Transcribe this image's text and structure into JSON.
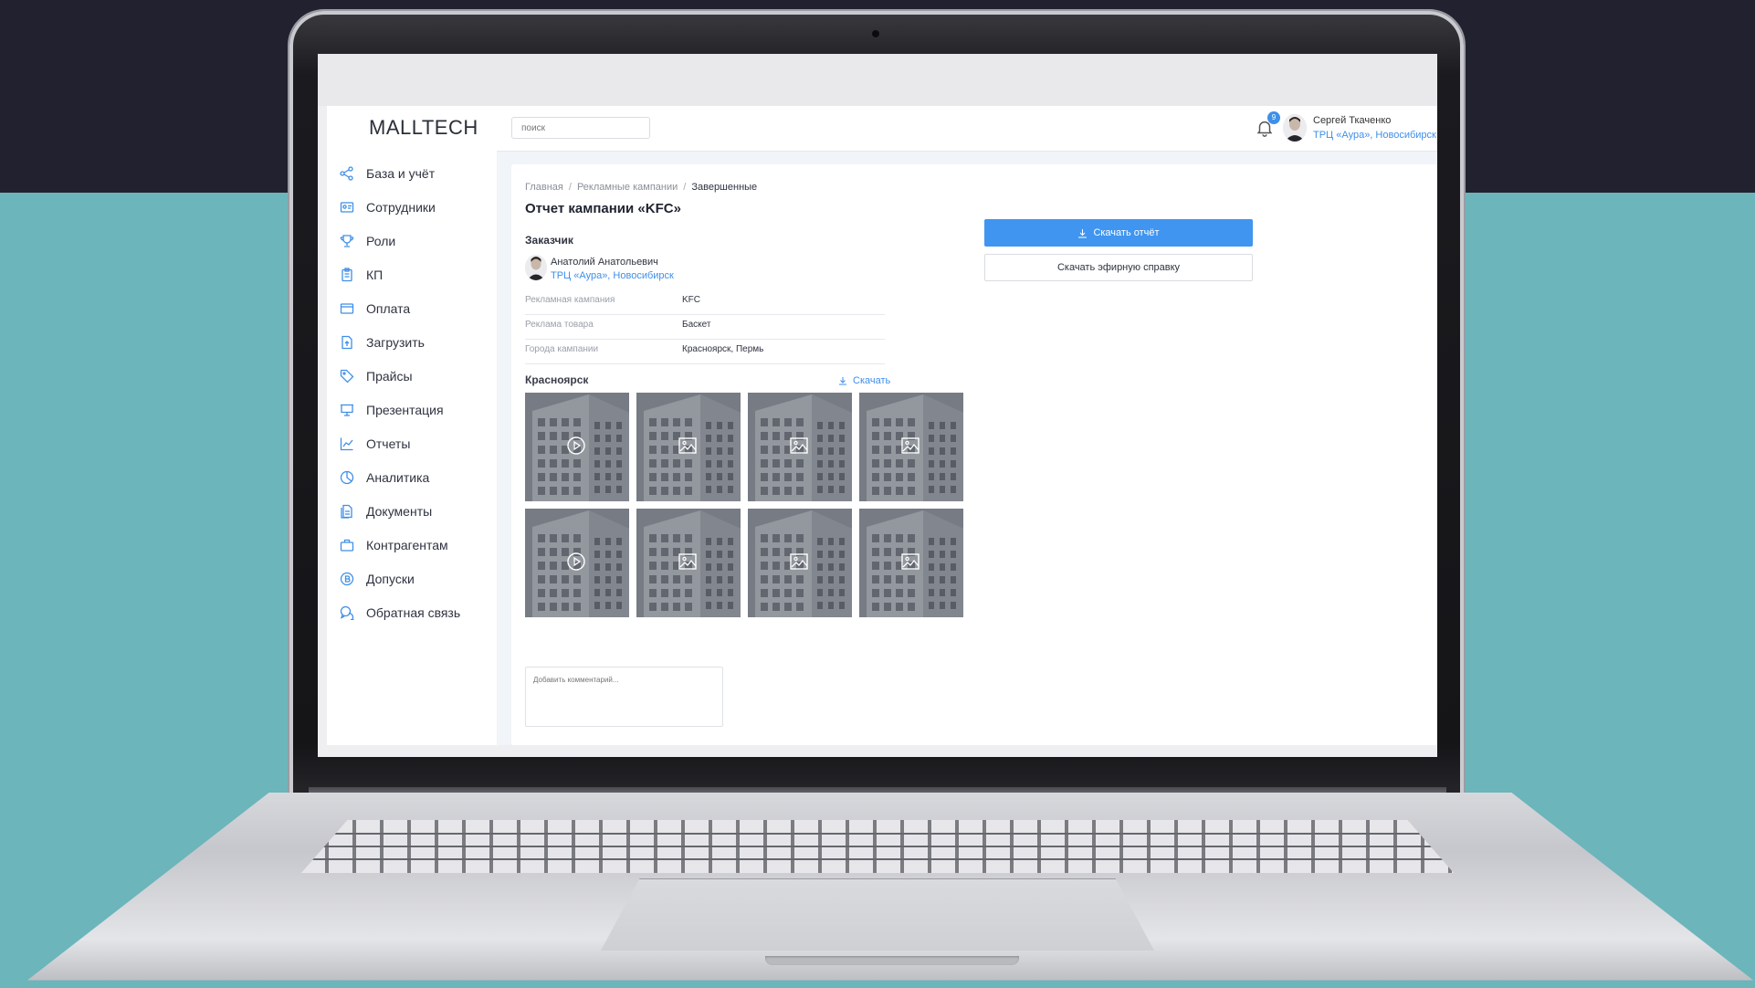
{
  "header": {
    "logo": "MALLTECH",
    "search_placeholder": "поиск",
    "notifications_count": "9",
    "user_name": "Сергей Ткаченко",
    "user_org": "ТРЦ «Аура», Новосибирск"
  },
  "sidebar": {
    "items": [
      {
        "label": "База и учёт",
        "icon": "database-nodes-icon"
      },
      {
        "label": "Сотрудники",
        "icon": "id-card-icon"
      },
      {
        "label": "Роли",
        "icon": "trophy-icon"
      },
      {
        "label": "КП",
        "icon": "clipboard-icon"
      },
      {
        "label": "Оплата",
        "icon": "wallet-icon"
      },
      {
        "label": "Загрузить",
        "icon": "file-upload-icon"
      },
      {
        "label": "Прайсы",
        "icon": "tag-icon"
      },
      {
        "label": "Презентация",
        "icon": "presentation-icon"
      },
      {
        "label": "Отчеты",
        "icon": "chart-line-icon"
      },
      {
        "label": "Аналитика",
        "icon": "pie-chart-icon"
      },
      {
        "label": "Документы",
        "icon": "documents-icon"
      },
      {
        "label": "Контрагентам",
        "icon": "briefcase-icon"
      },
      {
        "label": "Допуски",
        "icon": "badge-coin-icon"
      },
      {
        "label": "Обратная связь",
        "icon": "chat-icon"
      }
    ]
  },
  "main": {
    "breadcrumbs": [
      "Главная",
      "Рекламные кампании",
      "Завершенные"
    ],
    "title": "Отчет кампании «KFC»",
    "customer_heading": "Заказчик",
    "customer_name": "Анатолий Анатольевич",
    "customer_org": "ТРЦ «Аура», Новосибирск",
    "details": [
      {
        "label": "Рекламная кампания",
        "value": "KFC"
      },
      {
        "label": "Реклама товара",
        "value": "Баскет"
      },
      {
        "label": "Города кампании",
        "value": "Красноярск, Пермь"
      }
    ],
    "city": "Красноярск",
    "city_download": "Скачать",
    "media": [
      {
        "type": "video",
        "icon": "play-icon"
      },
      {
        "type": "image",
        "icon": "image-icon"
      },
      {
        "type": "image",
        "icon": "image-icon"
      },
      {
        "type": "image",
        "icon": "image-icon"
      },
      {
        "type": "video",
        "icon": "play-icon"
      },
      {
        "type": "image",
        "icon": "image-icon"
      },
      {
        "type": "image",
        "icon": "image-icon"
      },
      {
        "type": "image",
        "icon": "image-icon"
      }
    ],
    "comment_placeholder": "Добавить комментарий...",
    "download_report": "Скачать отчёт",
    "download_broadcast": "Скачать эфирную справку"
  },
  "colors": {
    "accent": "#3f95ef",
    "link": "#3f8fe8",
    "background_dark": "#22212f",
    "background_teal": "#6bb5bb"
  }
}
